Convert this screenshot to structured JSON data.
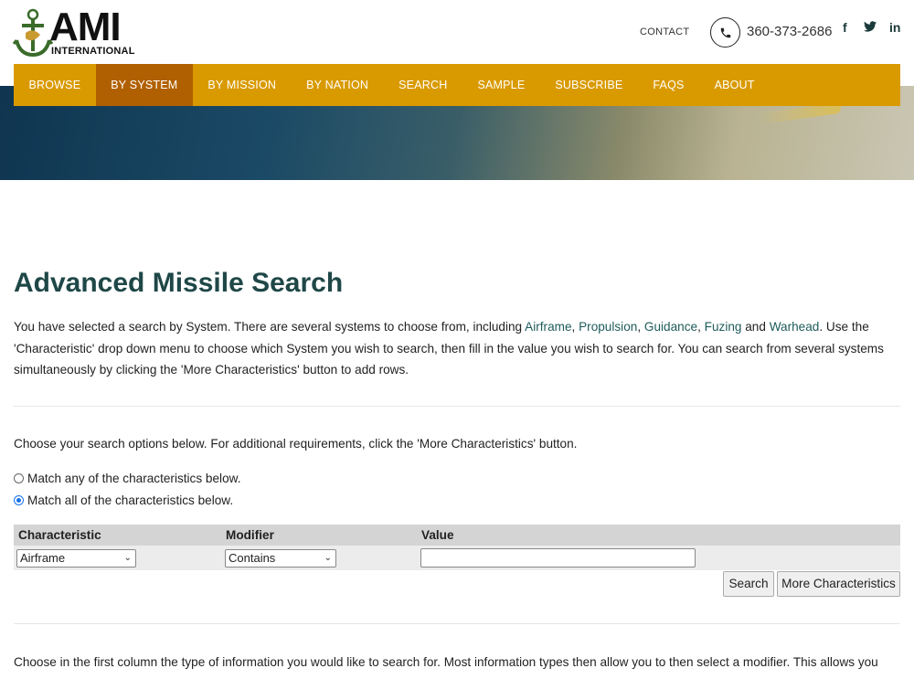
{
  "header": {
    "logo_text": "AMI",
    "logo_sub": "INTERNATIONAL",
    "contact_label": "CONTACT",
    "phone": "360-373-2686",
    "social": {
      "facebook": "f",
      "twitter": "t",
      "linkedin": "in"
    }
  },
  "nav": {
    "items": [
      {
        "label": "BROWSE"
      },
      {
        "label": "BY SYSTEM"
      },
      {
        "label": "BY MISSION"
      },
      {
        "label": "BY NATION"
      },
      {
        "label": "SEARCH"
      },
      {
        "label": "SAMPLE"
      },
      {
        "label": "SUBSCRIBE"
      },
      {
        "label": "FAQS"
      },
      {
        "label": "ABOUT"
      }
    ],
    "active": "BY SYSTEM"
  },
  "page": {
    "title": "Advanced Missile Search",
    "intro_1": "You have selected a search by System. There are several systems to choose from, including ",
    "link_airframe": "Airframe",
    "sep_1": ", ",
    "link_propulsion": "Propulsion",
    "sep_2": ", ",
    "link_guidance": "Guidance",
    "sep_3": ", ",
    "link_fuzing": "Fuzing",
    "sep_and": " and ",
    "link_warhead": "Warhead",
    "intro_2": ". Use the 'Characteristic' drop down menu to choose which System you wish to search, then fill in the value you wish to search for. You can search from several systems simultaneously by clicking the 'More Characteristics' button to add rows.",
    "choose_text": "Choose your search options below. For additional requirements, click the 'More Characteristics' button.",
    "radio_any": "Match any of the characteristics below.",
    "radio_all": "Match all of the characteristics below.",
    "bottom_text": "Choose in the first column the type of information you would like to search for. Most information types then allow you to then select a modifier. This allows you to"
  },
  "table": {
    "col_characteristic": "Characteristic",
    "col_modifier": "Modifier",
    "col_value": "Value",
    "characteristic_selected": "Airframe",
    "modifier_selected": "Contains",
    "value": ""
  },
  "buttons": {
    "search": "Search",
    "more": "More Characteristics"
  },
  "colors": {
    "nav_bg": "#d99a00",
    "nav_active": "#b06000",
    "title": "#1f4747",
    "link": "#1f5b5b"
  }
}
